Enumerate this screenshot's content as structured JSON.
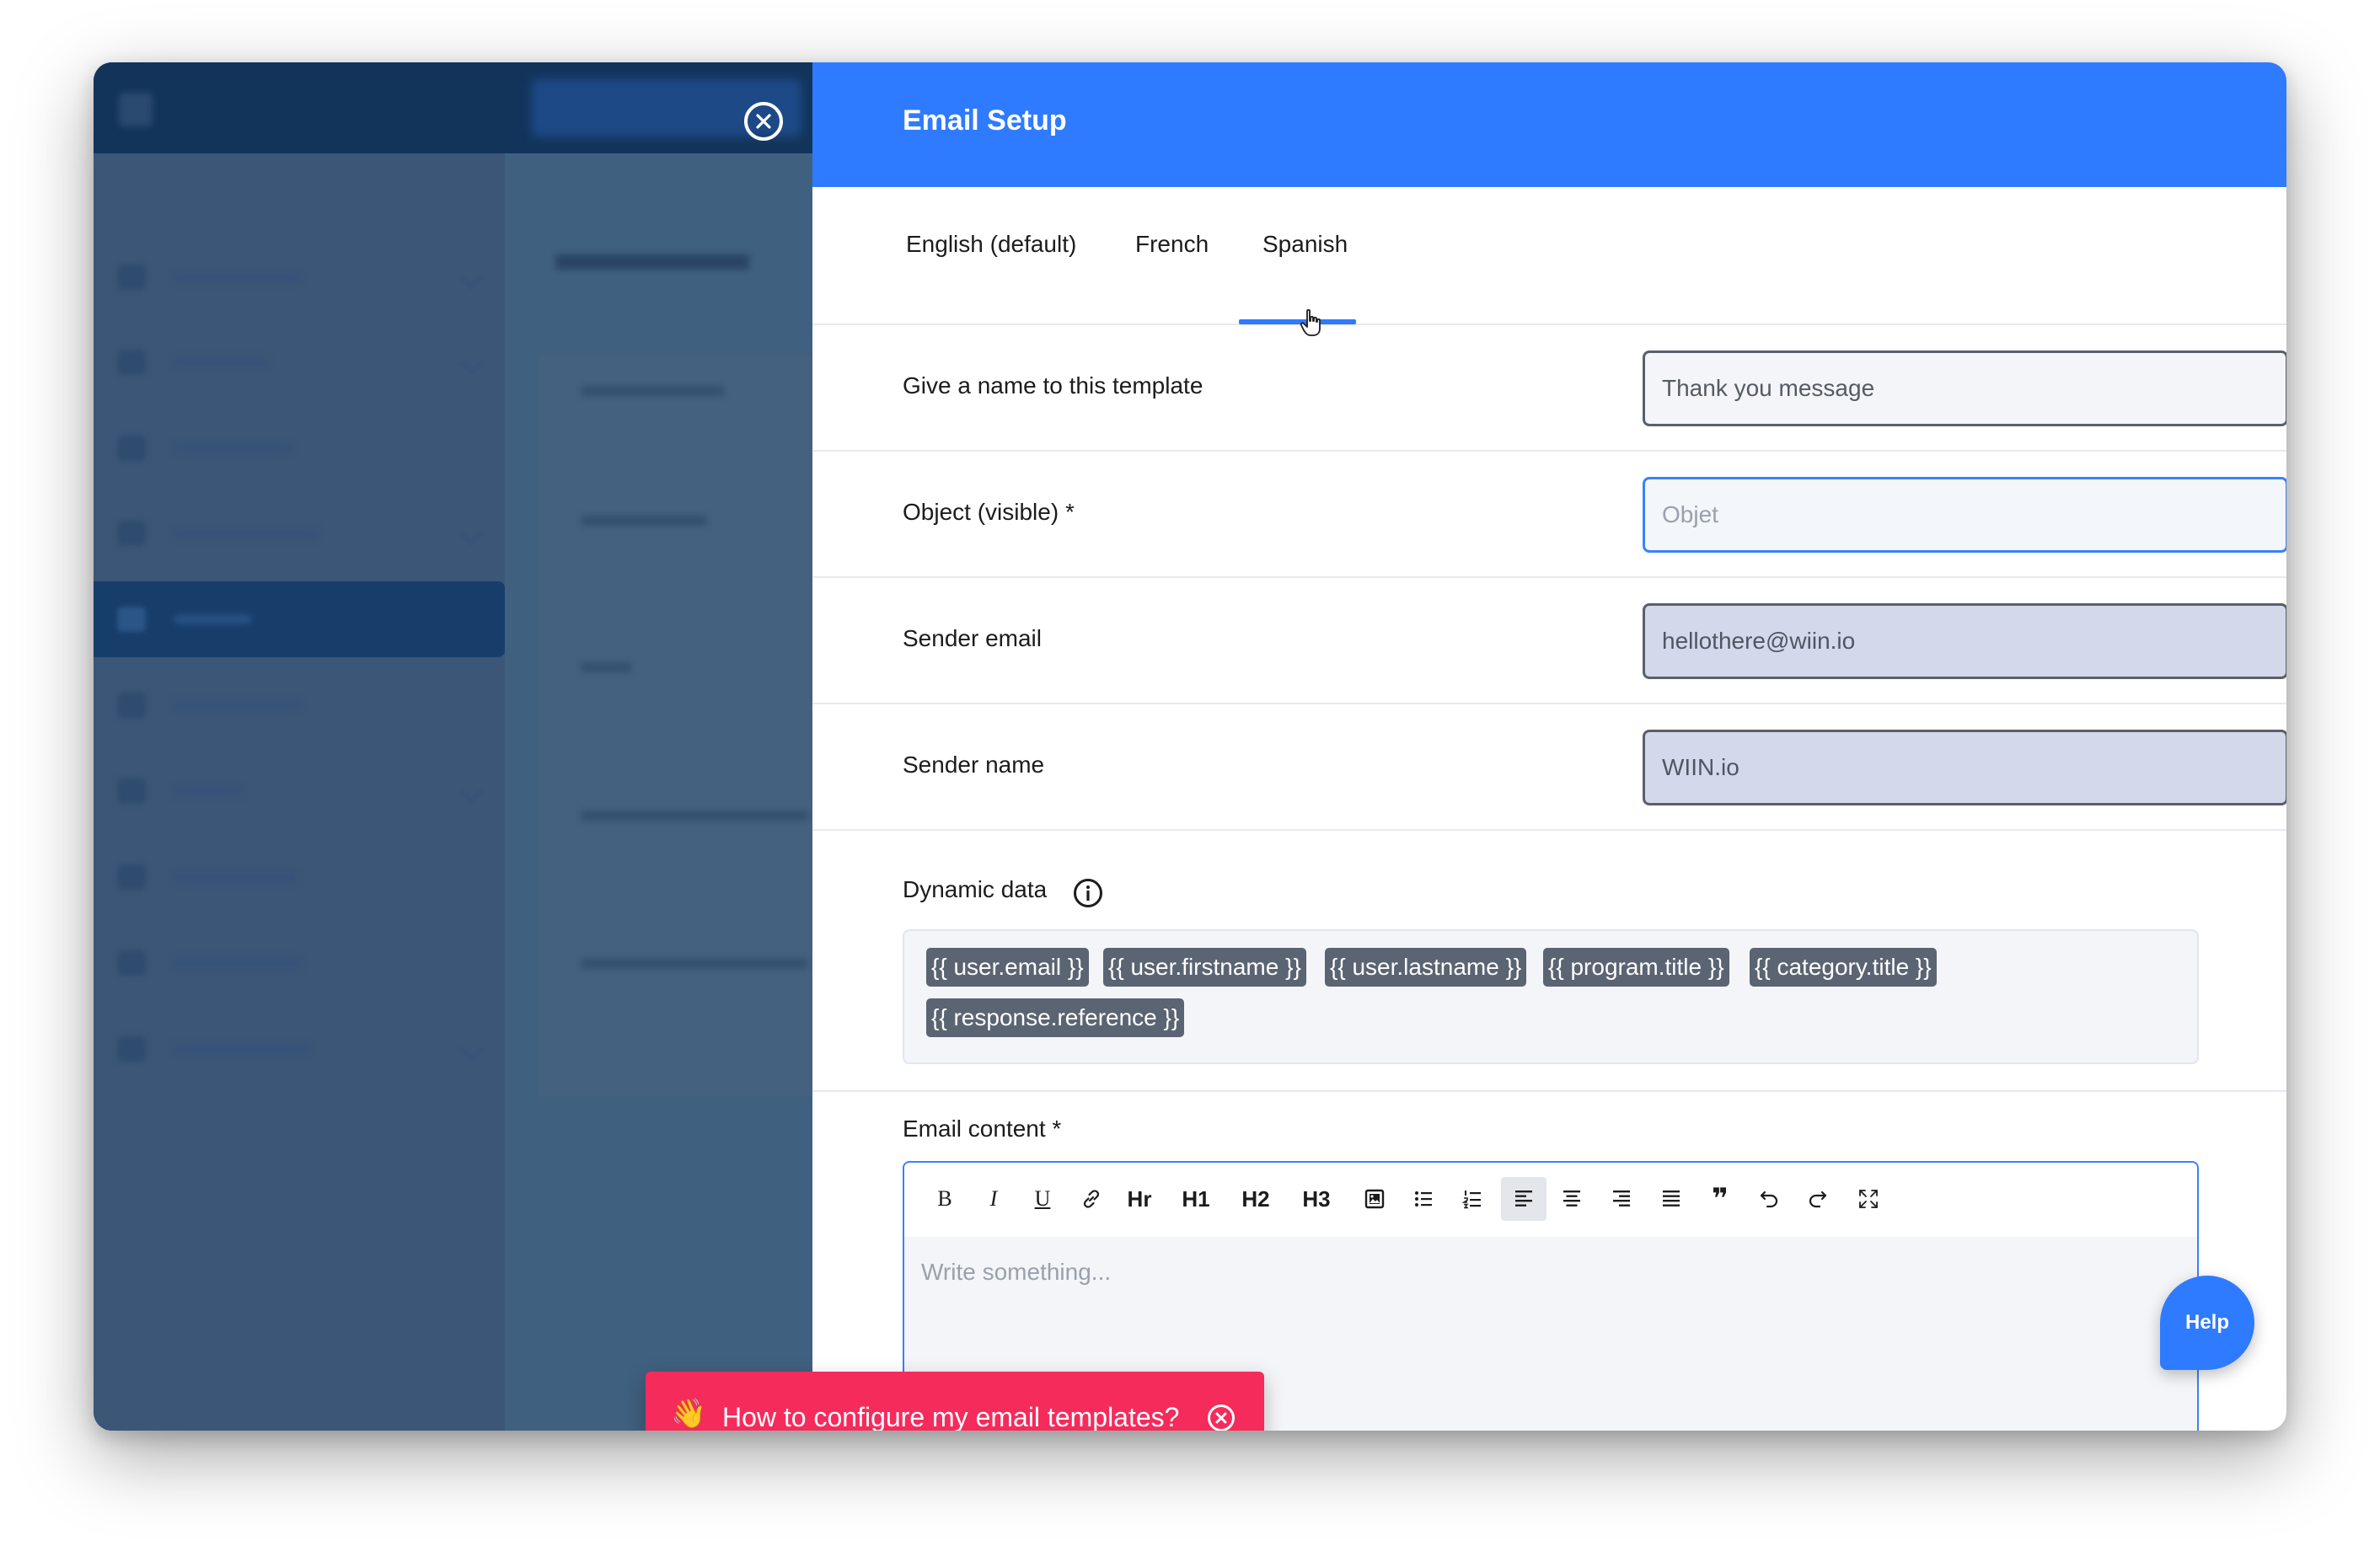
{
  "panel": {
    "title": "Email Setup",
    "tabs": [
      {
        "label": "English (default)"
      },
      {
        "label": "French"
      },
      {
        "label": "Spanish"
      }
    ],
    "active_tab": "Spanish"
  },
  "form": {
    "template_name": {
      "label": "Give a name to this template",
      "value": "Thank you message"
    },
    "object": {
      "label": "Object (visible) *",
      "placeholder": "Objet"
    },
    "sender_email": {
      "label": "Sender email",
      "value": "hellothere@wiin.io"
    },
    "sender_name": {
      "label": "Sender name",
      "value": "WIIN.io"
    }
  },
  "dynamic_data": {
    "label": "Dynamic data",
    "tags": [
      "{{ user.email }}",
      "{{ user.firstname }}",
      "{{ user.lastname }}",
      "{{ program.title }}",
      "{{ category.title }}",
      "{{ response.reference }}"
    ]
  },
  "email_content": {
    "label": "Email content *",
    "placeholder": "Write something...",
    "toolbar": {
      "bold": "B",
      "italic": "I",
      "underline": "U",
      "hr": "Hr",
      "h1": "H1",
      "h2": "H2",
      "h3": "H3",
      "quote": "❞"
    }
  },
  "help": {
    "label": "Help"
  },
  "tip": {
    "emoji": "👋",
    "text": "How to configure my email templates?"
  },
  "colors": {
    "accent": "#2f7bff",
    "tip": "#f52b5c",
    "tag": "#5b6472"
  }
}
